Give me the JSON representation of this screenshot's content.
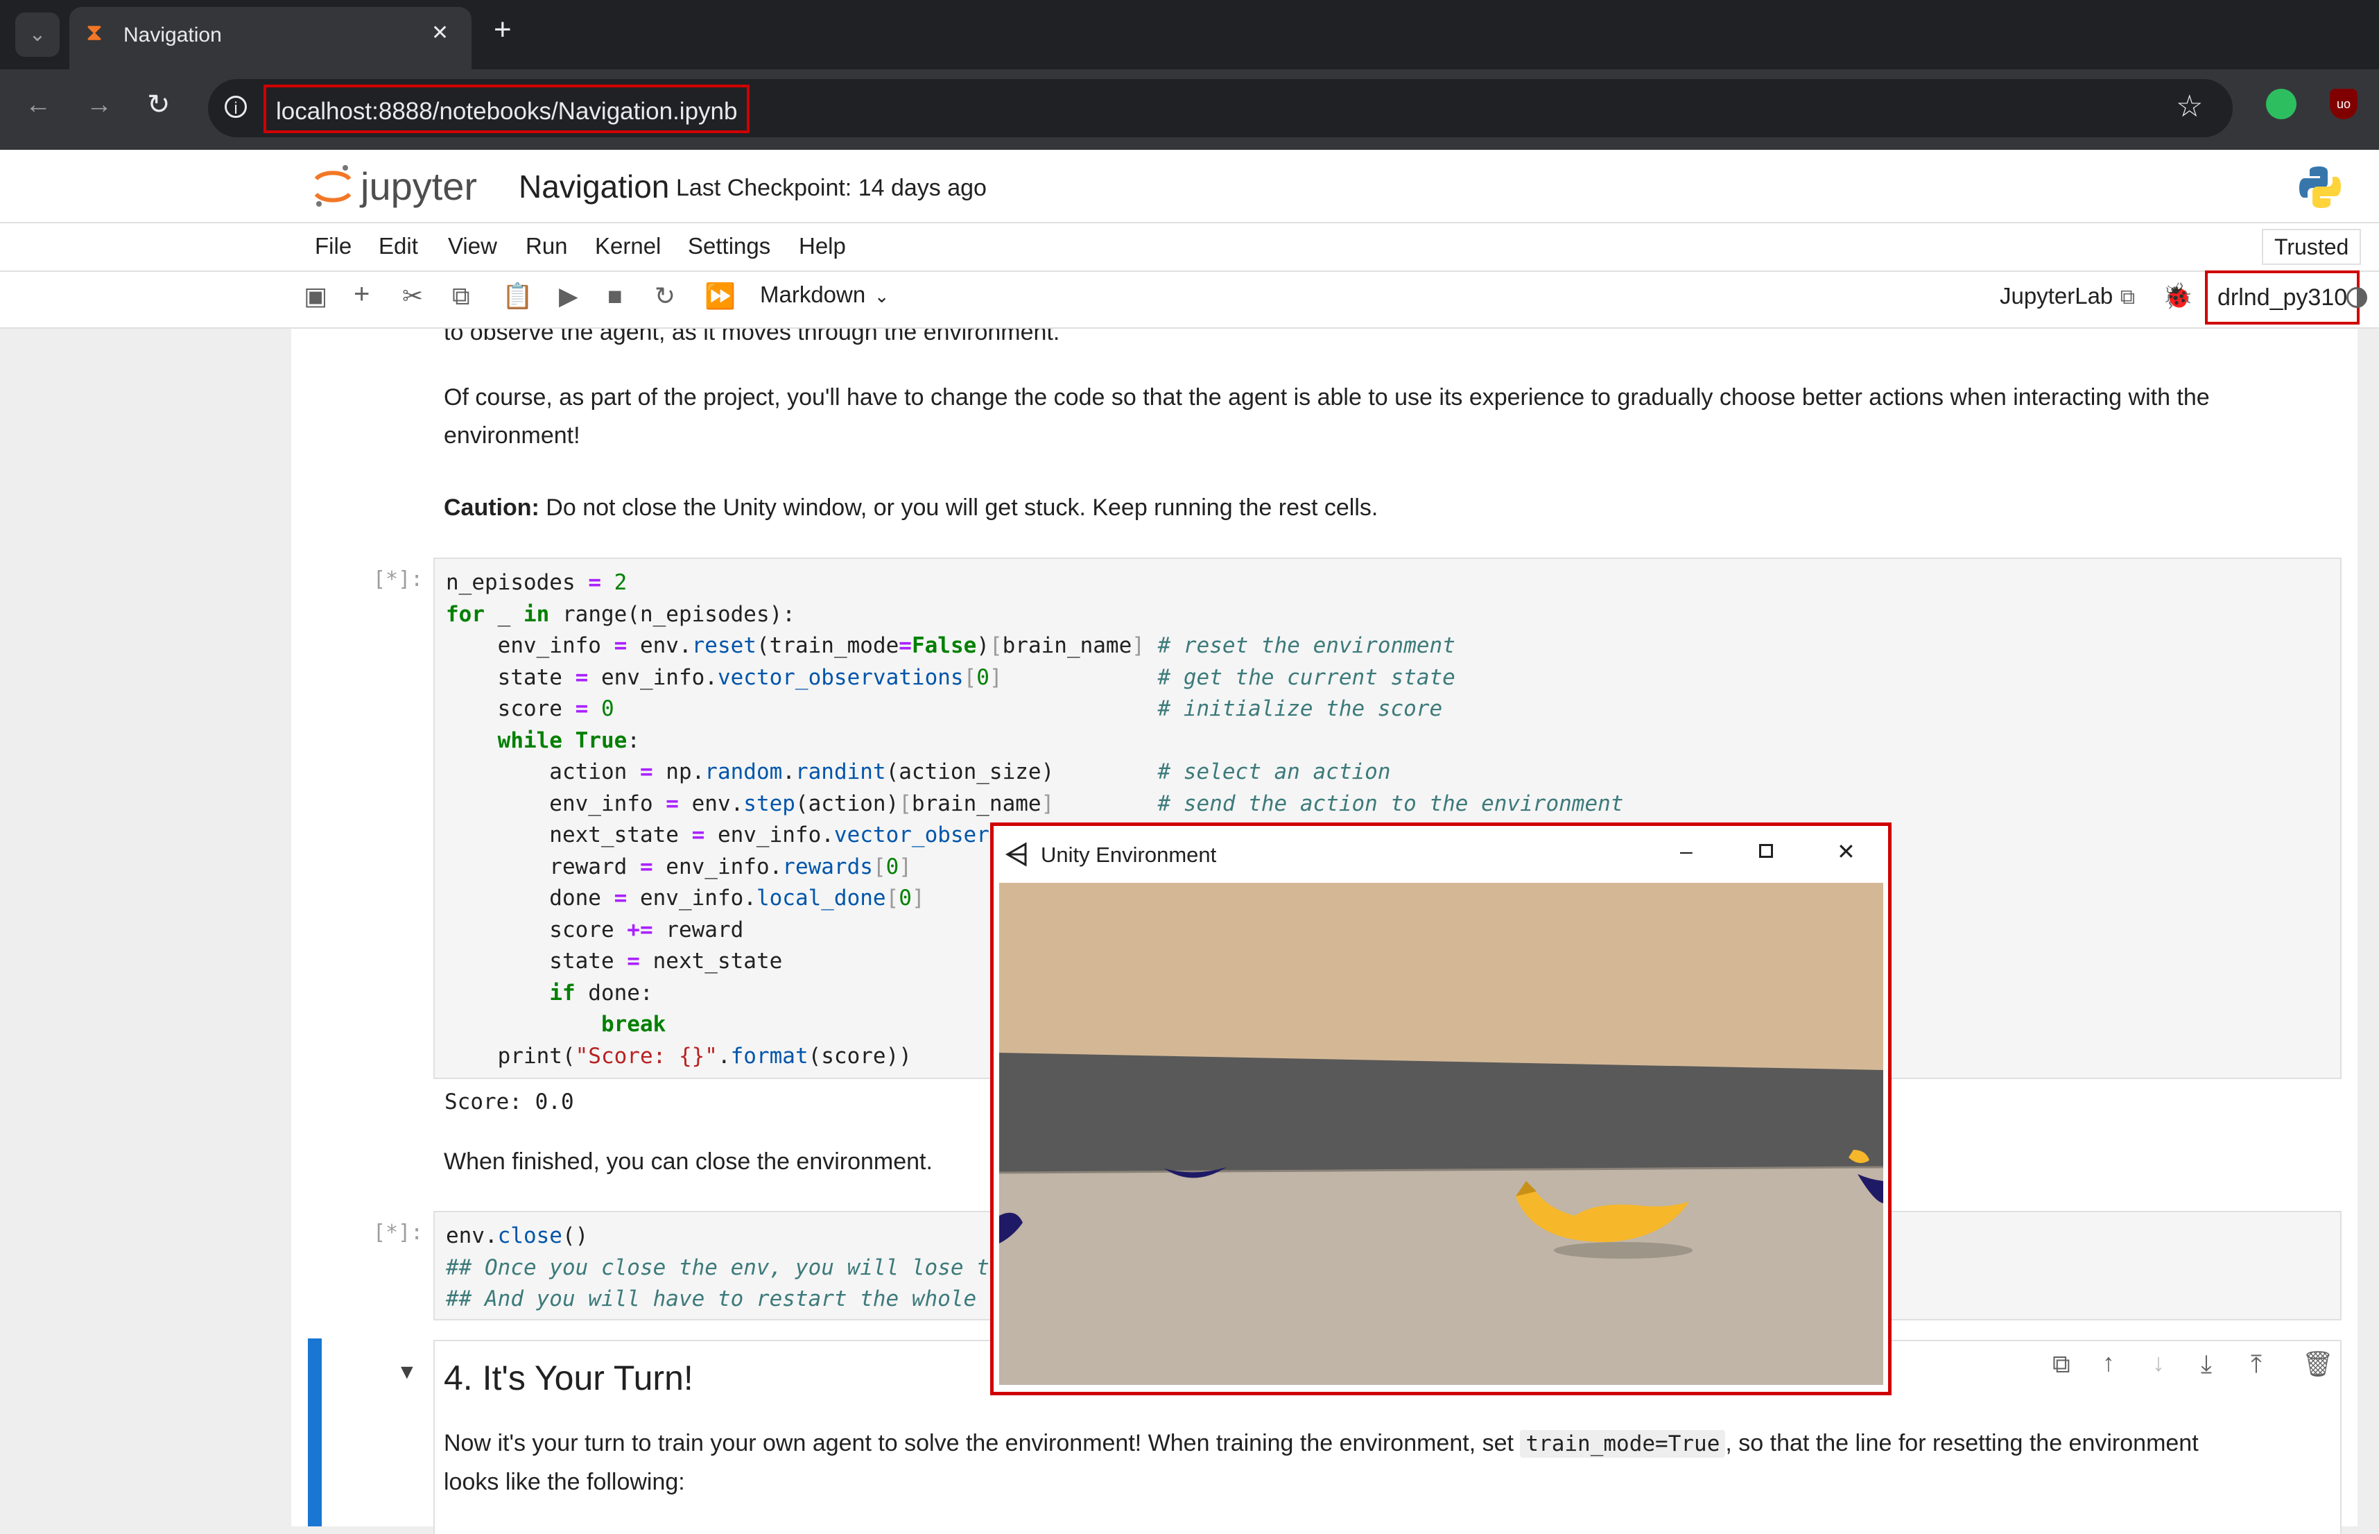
{
  "browser": {
    "tab_title": "Navigation",
    "url": "localhost:8888/notebooks/Navigation.ipynb",
    "new_tab_symbol": "+",
    "close_tab_symbol": "✕"
  },
  "jupyter": {
    "logo_text": "jupyter",
    "notebook_name": "Navigation",
    "checkpoint": "Last Checkpoint: 14 days ago",
    "menu": [
      "File",
      "Edit",
      "View",
      "Run",
      "Kernel",
      "Settings",
      "Help"
    ],
    "trusted": "Trusted",
    "cell_type": "Markdown",
    "jupyterlab": "JupyterLab",
    "kernel": "drlnd_py310"
  },
  "notebook": {
    "md1_partial": "to observe the agent, as it moves through the environment.",
    "md2_line1": "Of course, as part of the project, you'll have to change the code so that the agent is able to use its experience to gradually choose better actions when interacting with the",
    "md2_line2": "environment!",
    "caution_label": "Caution:",
    "caution_text": " Do not close the Unity window, or you will get stuck. Keep running the rest cells.",
    "cell1_prompt": "[*]:",
    "cell1_output": "Score: 0.0",
    "md3": "When finished, you can close the environment.",
    "cell2_prompt": "[*]:",
    "heading": "4. It's Your Turn!",
    "md4_line1_a": "Now it's your turn to train your own agent to solve the environment! When training the environment, set ",
    "md4_code": "train_mode=True",
    "md4_line1_b": ", so that the line for resetting the environment",
    "md4_line2": "looks like the following:"
  },
  "unity_window": {
    "title": "Unity Environment"
  },
  "colors": {
    "highlight": "#d00000",
    "cell_active_bar": "#1976d2"
  }
}
